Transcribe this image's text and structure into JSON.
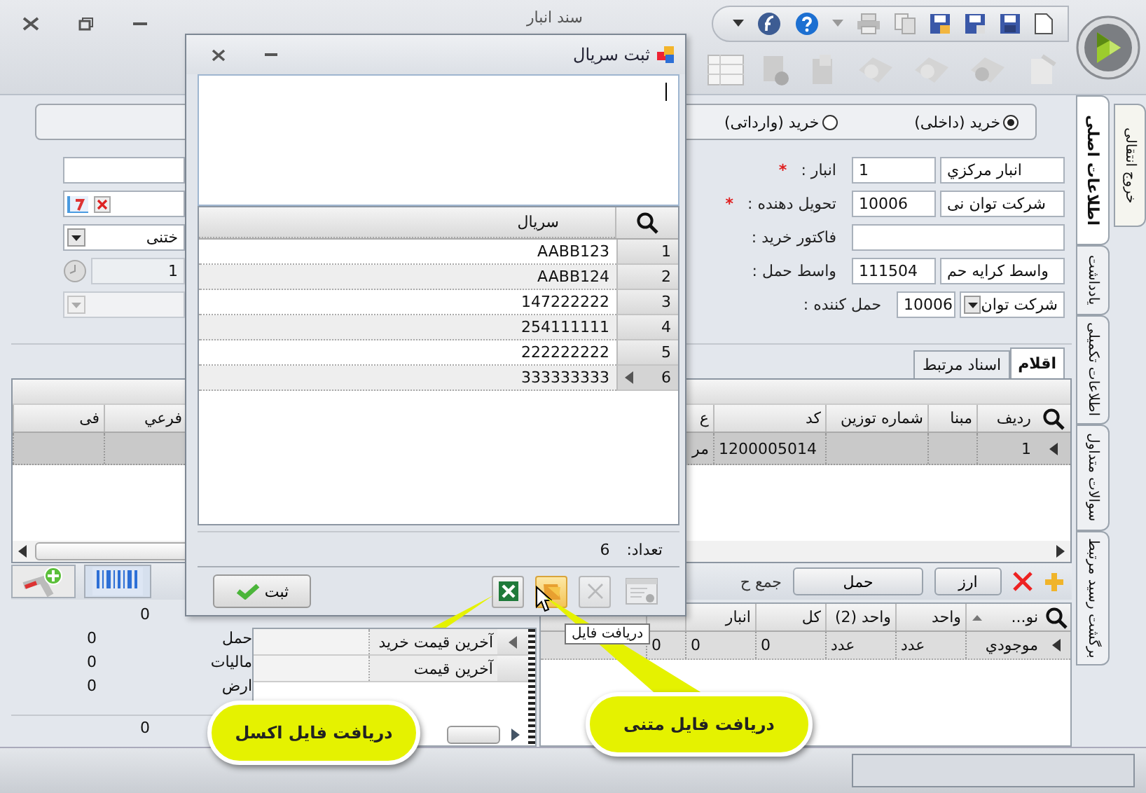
{
  "window": {
    "title": "سند انبار"
  },
  "purchase_types": [
    {
      "label": "خرید (داخلی)",
      "selected": true
    },
    {
      "label": "خرید (وارداتی)",
      "selected": false
    }
  ],
  "form_rows": [
    {
      "label": "انبار :",
      "mark": "*",
      "kind": "lookup",
      "code": "1",
      "name": "انبار مرکزي",
      "left": {
        "kind": "text"
      }
    },
    {
      "label": "تحویل دهنده :",
      "mark": "*",
      "kind": "lookup",
      "code": "10006",
      "name": "شرکت توان نی",
      "left": {
        "kind": "date"
      }
    },
    {
      "label": "فاکتور خرید :",
      "kind": "text",
      "left": {
        "kind": "combo",
        "value": "ختنی",
        "disabled": false
      }
    },
    {
      "label": "واسط حمل :",
      "kind": "lookup",
      "code": "111504",
      "name": "واسط کرایه حم",
      "left": {
        "kind": "counter",
        "value": "1",
        "disabled": true
      }
    },
    {
      "label": "حمل کننده :",
      "kind": "combo",
      "code": "10006",
      "name": "شرکت توان",
      "left": {
        "kind": "combo",
        "disabled": true
      }
    }
  ],
  "tabs": [
    {
      "label": "اقلام",
      "selected": true
    },
    {
      "label": "اسناد مرتبط",
      "selected": false
    }
  ],
  "items_table": {
    "columns": [
      "ردیف",
      "مبنا",
      "شماره توزین",
      "کد",
      "ع",
      "فرعي",
      "فی"
    ],
    "rows": [
      {
        "selected": true,
        "cells": [
          "1",
          "",
          "",
          "1200005014",
          "مر",
          "",
          ""
        ]
      }
    ]
  },
  "items_toolbar": {
    "buttons": [
      "ارز",
      "حمل"
    ],
    "total_label": "جمع ح"
  },
  "summary": [
    {
      "value": "0",
      "separated": false
    },
    {
      "label": "حمل",
      "value": "0",
      "separated": false
    },
    {
      "label": "مالیات",
      "value": "0",
      "separated": false
    },
    {
      "label": "ارض",
      "value": "0",
      "separated": false
    },
    {
      "value": "0",
      "separated": true
    }
  ],
  "price_list": [
    "آخرین قیمت خرید",
    "آخرین قیمت"
  ],
  "stock_table": {
    "columns": [
      {
        "label": "نو...",
        "sorted": true
      },
      {
        "label": "واحد",
        "sorted": false
      },
      {
        "label": "واحد (2)",
        "sorted": false
      },
      {
        "label": "کل",
        "sorted": false
      },
      {
        "label": "انبار",
        "sorted": false
      }
    ],
    "rows": [
      {
        "cells": [
          "موجودي",
          "عدد",
          "عدد",
          "0",
          "0",
          "0"
        ]
      }
    ]
  },
  "side_tabs": {
    "outer": [
      {
        "label": "خروج انتقالی",
        "selected": false
      }
    ],
    "inner": [
      {
        "label": "اطلاعات اصلی",
        "selected": true
      },
      {
        "label": "یادداشت",
        "selected": false
      },
      {
        "label": "اطلاعات تکمیلی",
        "selected": false
      },
      {
        "label": "سوالات متداول",
        "selected": false
      },
      {
        "label": "برگشت رسید مرتبط",
        "selected": false
      }
    ]
  },
  "dialog": {
    "title": "ثبت سریال",
    "serial_column": "سریال",
    "serials": [
      {
        "row": "1",
        "serial": "AABB123",
        "current": false
      },
      {
        "row": "2",
        "serial": "AABB124",
        "current": false
      },
      {
        "row": "3",
        "serial": "147222222",
        "current": false
      },
      {
        "row": "4",
        "serial": "254111111",
        "current": false
      },
      {
        "row": "5",
        "serial": "222222222",
        "current": false
      },
      {
        "row": "6",
        "serial": "333333333",
        "current": true
      }
    ],
    "count_label": "تعداد:",
    "count": "6",
    "save_button": "ثبت",
    "tools": [
      {
        "kind": "excel",
        "disabled": false
      },
      {
        "kind": "text",
        "disabled": false,
        "hovered": true
      },
      {
        "kind": "clear",
        "disabled": true
      },
      {
        "kind": "window",
        "disabled": true
      }
    ],
    "tooltip": "دریافت فایل"
  },
  "callouts": [
    {
      "kind": "text",
      "text": "دریافت فایل متنی"
    },
    {
      "kind": "excel",
      "text": "دریافت فایل اکسل"
    }
  ]
}
